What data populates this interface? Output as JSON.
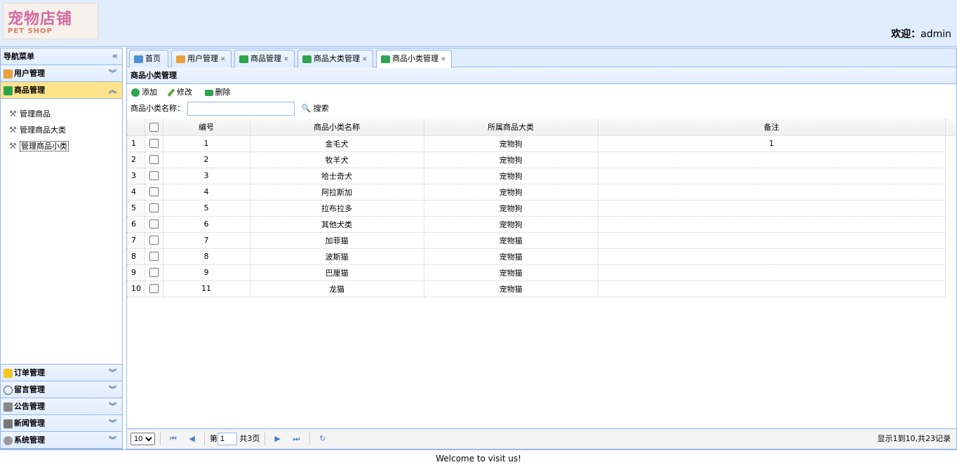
{
  "header": {
    "logo_text": "宠物店铺",
    "logo_sub": "PET SHOP",
    "welcome_label": "欢迎：",
    "user": "admin"
  },
  "nav": {
    "title": "导航菜单",
    "collapse_icon": "«",
    "groups": [
      {
        "label": "用户管理",
        "icon": "users-icon",
        "color": "#e9a23b"
      },
      {
        "label": "商品管理",
        "icon": "goods-icon",
        "color": "#2ea44f"
      },
      {
        "label": "订单管理",
        "icon": "order-icon",
        "color": "#f3c623"
      },
      {
        "label": "留言管理",
        "icon": "message-icon",
        "color": "#ffffff"
      },
      {
        "label": "公告管理",
        "icon": "notice-icon",
        "color": "#888888"
      },
      {
        "label": "新闻管理",
        "icon": "news-icon",
        "color": "#777777"
      },
      {
        "label": "系统管理",
        "icon": "settings-icon",
        "color": "#999999"
      }
    ],
    "goods_items": [
      "管理商品",
      "管理商品大类",
      "管理商品小类"
    ]
  },
  "tabs": [
    "首页",
    "用户管理",
    "商品管理",
    "商品大类管理",
    "商品小类管理"
  ],
  "panel_title": "商品小类管理",
  "toolbar": {
    "add": "添加",
    "edit": "修改",
    "delete": "删除"
  },
  "search": {
    "label": "商品小类名称：",
    "value": "",
    "button": "搜索"
  },
  "grid": {
    "columns": [
      "编号",
      "商品小类名称",
      "所属商品大类",
      "备注"
    ],
    "rows": [
      {
        "rn": "1",
        "id": "1",
        "name": "金毛犬",
        "category": "宠物狗",
        "remark": "1"
      },
      {
        "rn": "2",
        "id": "2",
        "name": "牧羊犬",
        "category": "宠物狗",
        "remark": ""
      },
      {
        "rn": "3",
        "id": "3",
        "name": "哈士奇犬",
        "category": "宠物狗",
        "remark": ""
      },
      {
        "rn": "4",
        "id": "4",
        "name": "阿拉斯加",
        "category": "宠物狗",
        "remark": ""
      },
      {
        "rn": "5",
        "id": "5",
        "name": "拉布拉多",
        "category": "宠物狗",
        "remark": ""
      },
      {
        "rn": "6",
        "id": "6",
        "name": "其他犬类",
        "category": "宠物狗",
        "remark": ""
      },
      {
        "rn": "7",
        "id": "7",
        "name": "加菲猫",
        "category": "宠物猫",
        "remark": ""
      },
      {
        "rn": "8",
        "id": "8",
        "name": "波斯猫",
        "category": "宠物猫",
        "remark": ""
      },
      {
        "rn": "9",
        "id": "9",
        "name": "巴厘猫",
        "category": "宠物猫",
        "remark": ""
      },
      {
        "rn": "10",
        "id": "11",
        "name": "龙猫",
        "category": "宠物猫",
        "remark": ""
      }
    ]
  },
  "pager": {
    "page_size": "10",
    "page_label": "第",
    "page": "1",
    "total_pages": "共3页",
    "info": "显示1到10,共23记录"
  },
  "footer": "Welcome to visit us!"
}
